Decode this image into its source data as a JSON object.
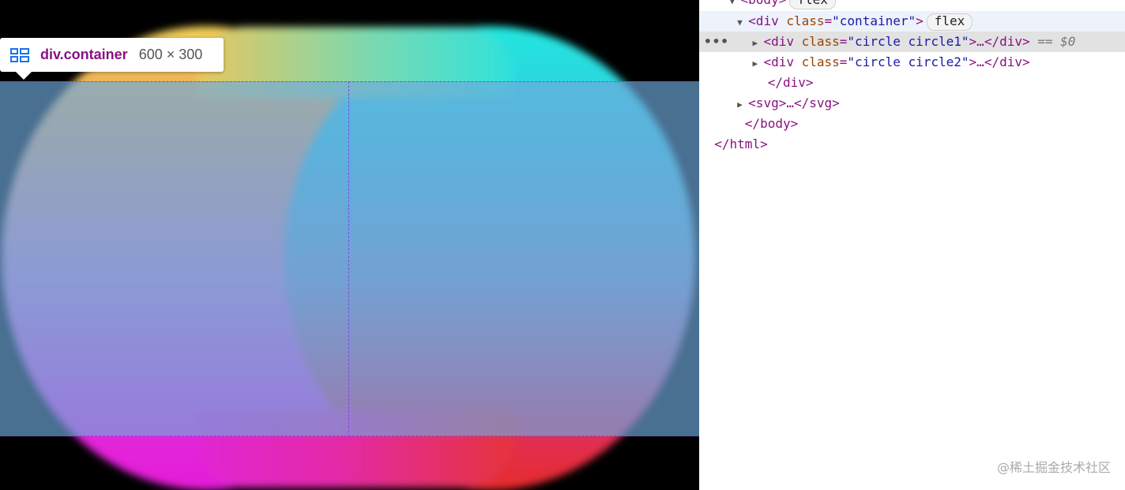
{
  "tooltip": {
    "element_name": "div.container",
    "dimensions": "600 × 300",
    "icon": "flex-container-icon"
  },
  "colors": {
    "highlight": "#6fa8dc",
    "tag": "#881280",
    "attribute": "#994500",
    "value": "#1a1aa6"
  },
  "elements_panel": {
    "body_open": "<body>",
    "body_badge": "flex",
    "container_open_tag": "<div",
    "container_attr_name": "class",
    "container_attr_value": "\"container\"",
    "container_close_bracket": ">",
    "container_badge": "flex",
    "circle1_open_tag": "<div",
    "circle1_attr_name": "class",
    "circle1_attr_value": "\"circle circle1\"",
    "circle1_tail": ">…</div>",
    "circle1_console_ref": "== $0",
    "circle2_open_tag": "<div",
    "circle2_attr_name": "class",
    "circle2_attr_value": "\"circle circle2\"",
    "circle2_tail": ">…</div>",
    "div_close": "</div>",
    "svg_node": "<svg>…</svg>",
    "body_close": "</body>",
    "html_close": "</html>",
    "gutter_dots": "•••"
  },
  "watermark": "@稀土掘金技术社区"
}
